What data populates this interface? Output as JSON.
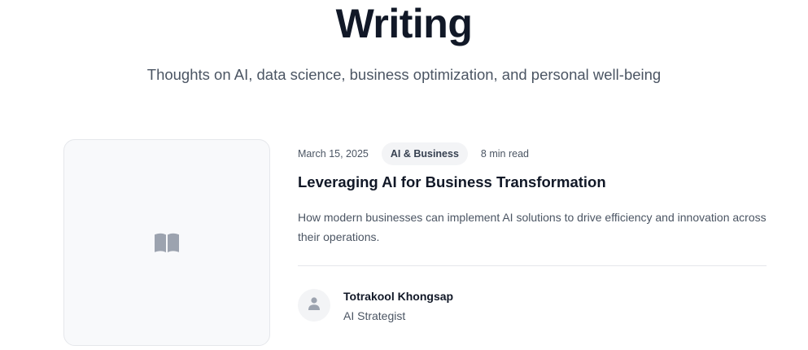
{
  "hero": {
    "title": "Writing",
    "subtitle": "Thoughts on AI, data science, business optimization, and personal well-being"
  },
  "post": {
    "date": "March 15, 2025",
    "category": "AI & Business",
    "read_time": "8 min read",
    "title": "Leveraging AI for Business Transformation",
    "excerpt": "How modern businesses can implement AI solutions to drive efficiency and innovation across their operations.",
    "thumbnail_icon": "book-icon",
    "author": {
      "name": "Totrakool Khongsap",
      "role": "AI Strategist",
      "avatar_icon": "user-icon"
    }
  },
  "colors": {
    "text_primary": "#111827",
    "text_secondary": "#4b5563",
    "icon_gray": "#9ca3af",
    "tag_background": "#f3f4f6",
    "border": "#e5e7eb"
  }
}
